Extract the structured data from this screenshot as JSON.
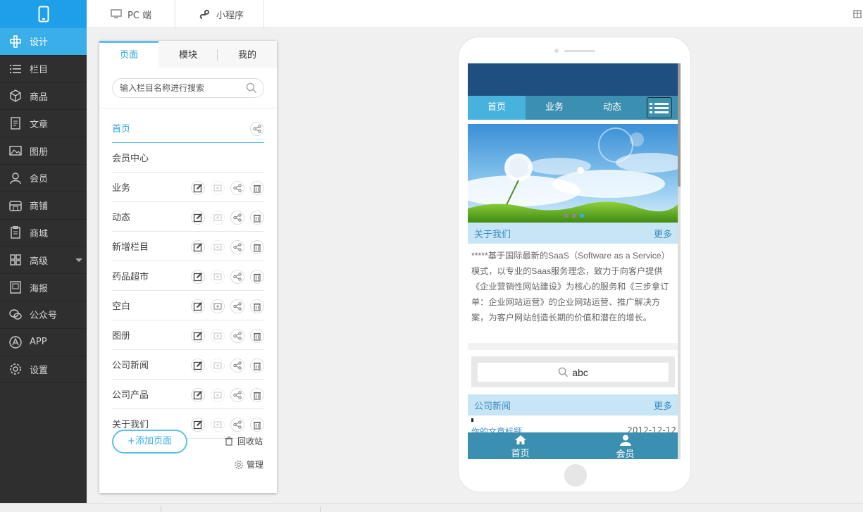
{
  "topbar": {
    "pc_label": "PC 端",
    "mini_label": "小程序"
  },
  "sidebar": {
    "items": [
      {
        "label": "设计",
        "icon": "design-icon",
        "active": true
      },
      {
        "label": "栏目",
        "icon": "list-icon"
      },
      {
        "label": "商品",
        "icon": "box-icon"
      },
      {
        "label": "文章",
        "icon": "article-icon"
      },
      {
        "label": "图册",
        "icon": "image-icon"
      },
      {
        "label": "会员",
        "icon": "user-icon"
      },
      {
        "label": "商铺",
        "icon": "shop-icon"
      },
      {
        "label": "商城",
        "icon": "mall-icon"
      },
      {
        "label": "高级",
        "icon": "grid-icon"
      },
      {
        "label": "海报",
        "icon": "poster-icon"
      },
      {
        "label": "公众号",
        "icon": "wechat-icon"
      },
      {
        "label": "APP",
        "icon": "app-icon"
      },
      {
        "label": "设置",
        "icon": "gear-icon"
      }
    ]
  },
  "panel": {
    "tabs": [
      "页面",
      "模块",
      "我的"
    ],
    "search_placeholder": "输入栏目名称进行搜索",
    "pages": [
      "首页",
      "会员中心",
      "业务",
      "动态",
      "新增栏目",
      "药品超市",
      "空白",
      "图册",
      "公司新闻",
      "公司产品",
      "关于我们"
    ],
    "add_page": "+添加页面",
    "recycle": "回收站",
    "manage": "管理"
  },
  "phone": {
    "nav": [
      "首页",
      "业务",
      "动态"
    ],
    "about_title": "关于我们",
    "more": "更多",
    "about_text": "*****基于国际最新的SaaS（Software as a Service）模式，以专业的Saas服务理念，致力于向客户提供《企业营销性网站建设》为核心的服务和《三步拿订单：企业网站运营》的企业网站运营、推广解决方案，为客户网站创造长期的价值和潜在的增长。",
    "search_value": "abc",
    "news_title": "公司新闻",
    "news_item": "你的文章标题",
    "news_date": "2012-12-12",
    "footer": [
      "首页",
      "会员"
    ]
  },
  "colors": {
    "accent": "#1e9fe8",
    "sidebar_bg": "#2f2f2f",
    "phone_header": "#1f4e80",
    "phone_nav": "#3b8fb0"
  }
}
